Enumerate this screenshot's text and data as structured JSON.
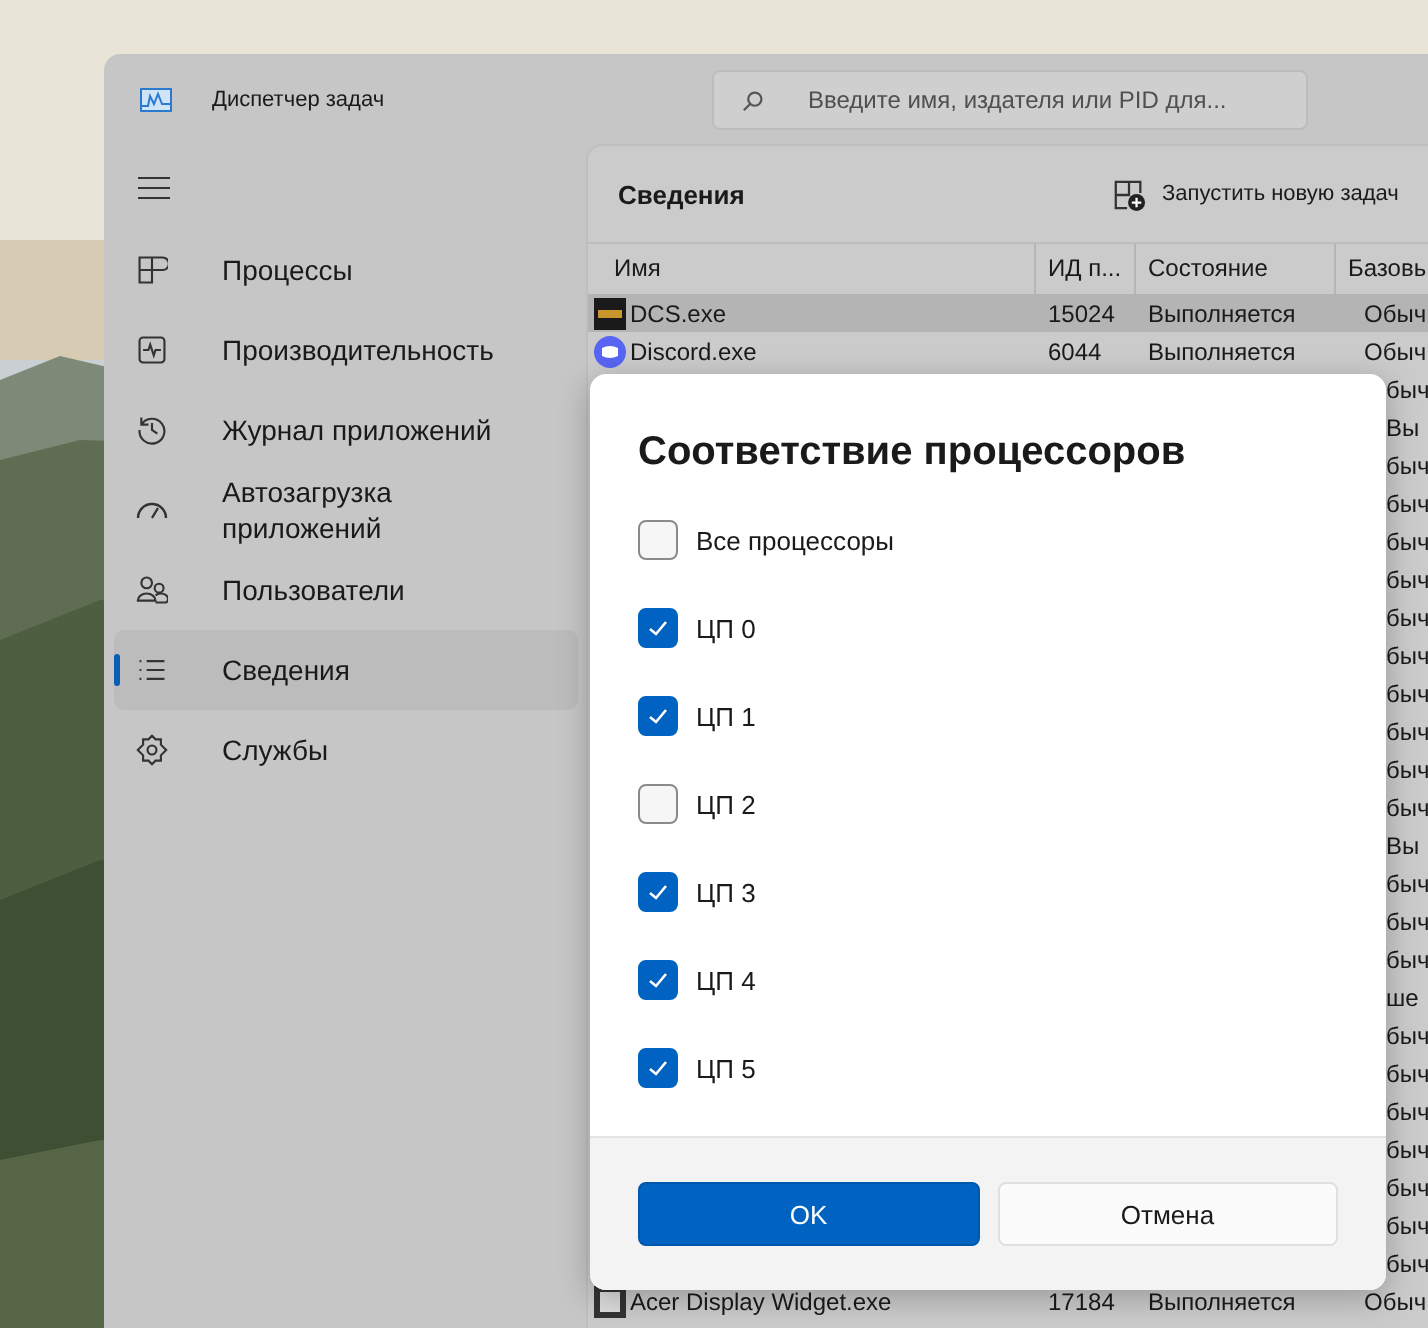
{
  "window": {
    "title": "Диспетчер задач"
  },
  "search": {
    "placeholder": "Введите имя, издателя или PID для..."
  },
  "sidebar": {
    "items": [
      {
        "label": "Процессы",
        "selected": false
      },
      {
        "label": "Производительность",
        "selected": false
      },
      {
        "label": "Журнал приложений",
        "selected": false
      },
      {
        "label": "Автозагрузка приложений",
        "selected": false
      },
      {
        "label": "Пользователи",
        "selected": false
      },
      {
        "label": "Сведения",
        "selected": true
      },
      {
        "label": "Службы",
        "selected": false
      }
    ]
  },
  "page": {
    "title": "Сведения",
    "run_task": "Запустить новую задач"
  },
  "table": {
    "columns": [
      "Имя",
      "ИД п...",
      "Состояние",
      "Базовь"
    ],
    "rows": [
      {
        "kind": "full",
        "name": "DCS.exe",
        "pid": "15024",
        "state": "Выполняется",
        "base": "Обыч",
        "selected": true
      },
      {
        "kind": "full",
        "name": "Discord.exe",
        "pid": "6044",
        "state": "Выполняется",
        "base": "Обыч",
        "selected": false
      },
      {
        "kind": "fragment",
        "base": "быч"
      },
      {
        "kind": "fragment",
        "base": "Вы"
      },
      {
        "kind": "fragment",
        "base": "быч"
      },
      {
        "kind": "fragment",
        "base": "быч"
      },
      {
        "kind": "fragment",
        "base": "быч"
      },
      {
        "kind": "fragment",
        "base": "быч"
      },
      {
        "kind": "fragment",
        "base": "быч"
      },
      {
        "kind": "fragment",
        "base": "быч"
      },
      {
        "kind": "fragment",
        "base": "быч"
      },
      {
        "kind": "fragment",
        "base": "быч"
      },
      {
        "kind": "fragment",
        "base": "быч"
      },
      {
        "kind": "fragment",
        "base": "быч"
      },
      {
        "kind": "fragment",
        "base": "Вы"
      },
      {
        "kind": "fragment",
        "base": "быч"
      },
      {
        "kind": "fragment",
        "base": "быч"
      },
      {
        "kind": "fragment",
        "base": "быч"
      },
      {
        "kind": "fragment",
        "base": "ше"
      },
      {
        "kind": "fragment",
        "base": "быч"
      },
      {
        "kind": "fragment",
        "base": "быч"
      },
      {
        "kind": "fragment",
        "base": "быч"
      },
      {
        "kind": "fragment",
        "base": "быч"
      },
      {
        "kind": "fragment",
        "base": "быч"
      },
      {
        "kind": "fragment",
        "base": "быч"
      },
      {
        "kind": "fragment",
        "base": "быч"
      },
      {
        "kind": "full",
        "name": "Acer Display Widget.exe",
        "pid": "17184",
        "state": "Выполняется",
        "base": "Обыч",
        "selected": false
      }
    ]
  },
  "dialog": {
    "title": "Соответствие процессоров",
    "options": [
      {
        "label": "Все процессоры",
        "checked": false
      },
      {
        "label": "ЦП 0",
        "checked": true
      },
      {
        "label": "ЦП 1",
        "checked": true
      },
      {
        "label": "ЦП 2",
        "checked": false
      },
      {
        "label": "ЦП 3",
        "checked": true
      },
      {
        "label": "ЦП 4",
        "checked": true
      },
      {
        "label": "ЦП 5",
        "checked": true
      }
    ],
    "buttons": [
      {
        "label": "OK",
        "kind": "primary"
      },
      {
        "label": "Отмена",
        "kind": "secondary"
      }
    ]
  }
}
